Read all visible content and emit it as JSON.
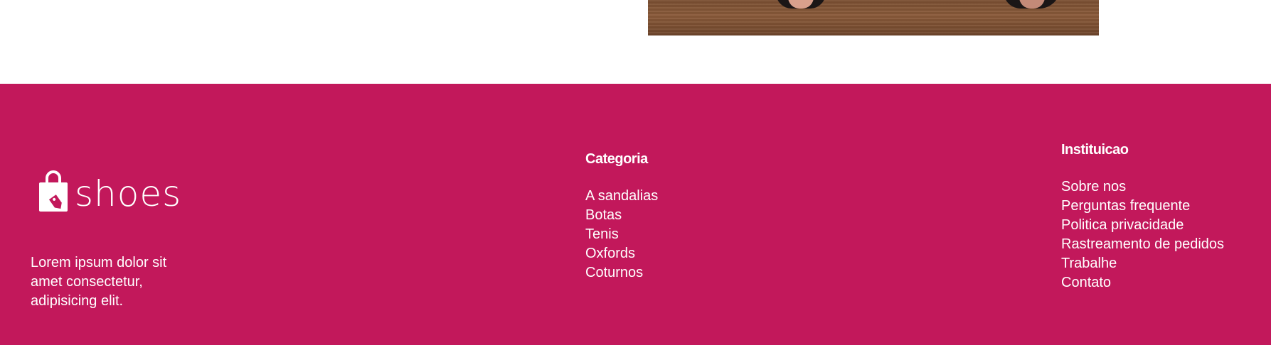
{
  "colors": {
    "footer_background": "#c2185b",
    "footer_text": "#ffffff",
    "page_background": "#ffffff"
  },
  "hero": {
    "image_icon": "photo-of-shoes-on-wood-floor"
  },
  "brand": {
    "logo_icon": "shopping-bag-with-tag-icon",
    "name": "shoes",
    "description": "Lorem ipsum dolor sit amet consectetur, adipisicing elit."
  },
  "categoria": {
    "title": "Categoria",
    "items": [
      "A sandalias",
      "Botas",
      "Tenis",
      "Oxfords",
      "Coturnos"
    ]
  },
  "instituicao": {
    "title": "Instituicao",
    "items": [
      "Sobre nos",
      "Perguntas frequente",
      "Politica privacidade",
      "Rastreamento de pedidos",
      "Trabalhe",
      "Contato"
    ]
  }
}
